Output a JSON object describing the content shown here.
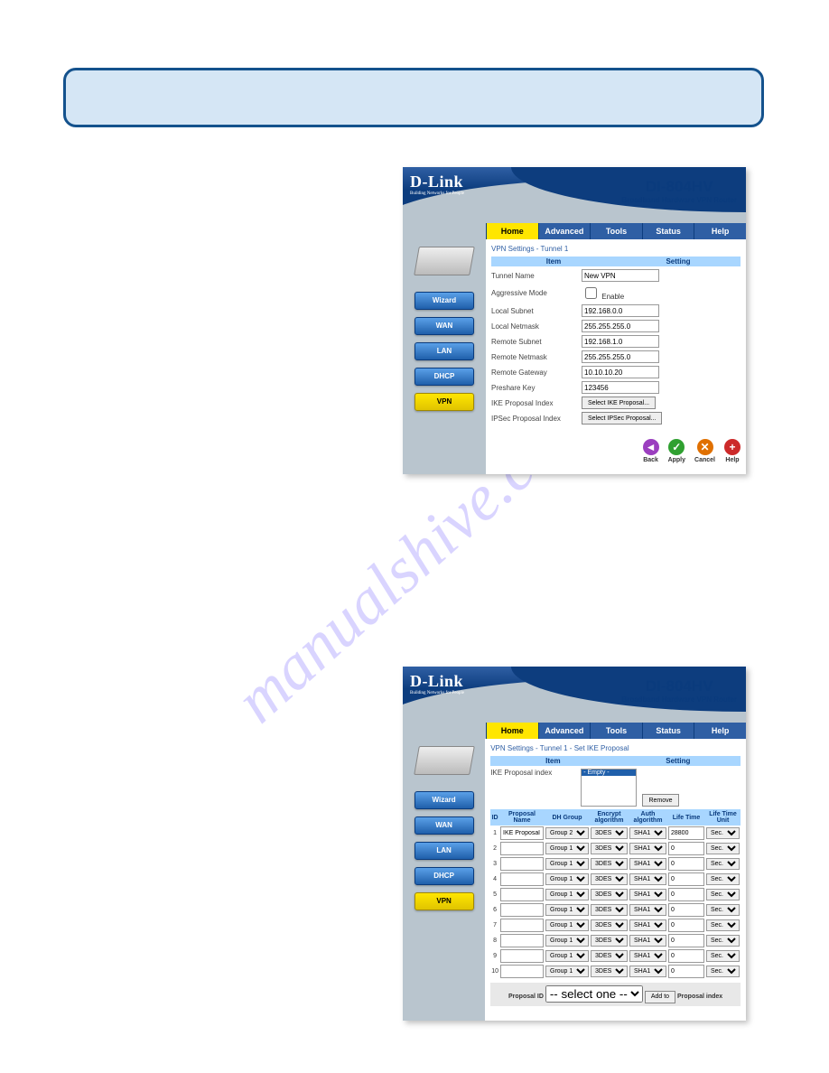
{
  "watermark": "manualshive.com",
  "brand": "D-Link",
  "brand_tagline": "Building Networks for People",
  "product_model": "DI-804HV",
  "product_subtitle": "Broadband Hardware VPN Router",
  "tabs": {
    "home": "Home",
    "advanced": "Advanced",
    "tools": "Tools",
    "status": "Status",
    "help": "Help"
  },
  "sidebar": {
    "wizard": "Wizard",
    "wan": "WAN",
    "lan": "LAN",
    "dhcp": "DHCP",
    "vpn": "VPN"
  },
  "actions": {
    "back": "Back",
    "apply": "Apply",
    "cancel": "Cancel",
    "help": "Help"
  },
  "shot1": {
    "crumb": "VPN Settings - Tunnel 1",
    "headers": {
      "item": "Item",
      "setting": "Setting"
    },
    "rows": {
      "tunnel_name": {
        "label": "Tunnel Name",
        "value": "New VPN"
      },
      "aggressive": {
        "label": "Aggressive Mode",
        "checkbox_label": "Enable"
      },
      "local_subnet": {
        "label": "Local Subnet",
        "value": "192.168.0.0"
      },
      "local_mask": {
        "label": "Local Netmask",
        "value": "255.255.255.0"
      },
      "remote_subnet": {
        "label": "Remote Subnet",
        "value": "192.168.1.0"
      },
      "remote_mask": {
        "label": "Remote Netmask",
        "value": "255.255.255.0"
      },
      "remote_gw": {
        "label": "Remote Gateway",
        "value": "10.10.10.20"
      },
      "preshare": {
        "label": "Preshare Key",
        "value": "123456"
      },
      "ike_idx": {
        "label": "IKE Proposal Index",
        "button": "Select IKE Proposal..."
      },
      "ipsec_idx": {
        "label": "IPSec Proposal Index",
        "button": "Select IPSec Proposal..."
      }
    }
  },
  "shot2": {
    "crumb": "VPN Settings - Tunnel 1 - Set IKE Proposal",
    "headers": {
      "item": "Item",
      "setting": "Setting"
    },
    "ike_label": "IKE Proposal index",
    "list_selected": "- Empty -",
    "remove": "Remove",
    "cols": {
      "id": "ID",
      "name": "Proposal Name",
      "dh": "DH Group",
      "enc": "Encrypt algorithm",
      "auth": "Auth algorithm",
      "life": "Life Time",
      "unit": "Life Time Unit"
    },
    "rows": [
      {
        "id": "1",
        "name": "IKE Proposal",
        "dh": "Group 2",
        "enc": "3DES",
        "auth": "SHA1",
        "life": "28800",
        "unit": "Sec."
      },
      {
        "id": "2",
        "name": "",
        "dh": "Group 1",
        "enc": "3DES",
        "auth": "SHA1",
        "life": "0",
        "unit": "Sec."
      },
      {
        "id": "3",
        "name": "",
        "dh": "Group 1",
        "enc": "3DES",
        "auth": "SHA1",
        "life": "0",
        "unit": "Sec."
      },
      {
        "id": "4",
        "name": "",
        "dh": "Group 1",
        "enc": "3DES",
        "auth": "SHA1",
        "life": "0",
        "unit": "Sec."
      },
      {
        "id": "5",
        "name": "",
        "dh": "Group 1",
        "enc": "3DES",
        "auth": "SHA1",
        "life": "0",
        "unit": "Sec."
      },
      {
        "id": "6",
        "name": "",
        "dh": "Group 1",
        "enc": "3DES",
        "auth": "SHA1",
        "life": "0",
        "unit": "Sec."
      },
      {
        "id": "7",
        "name": "",
        "dh": "Group 1",
        "enc": "3DES",
        "auth": "SHA1",
        "life": "0",
        "unit": "Sec."
      },
      {
        "id": "8",
        "name": "",
        "dh": "Group 1",
        "enc": "3DES",
        "auth": "SHA1",
        "life": "0",
        "unit": "Sec."
      },
      {
        "id": "9",
        "name": "",
        "dh": "Group 1",
        "enc": "3DES",
        "auth": "SHA1",
        "life": "0",
        "unit": "Sec."
      },
      {
        "id": "10",
        "name": "",
        "dh": "Group 1",
        "enc": "3DES",
        "auth": "SHA1",
        "life": "0",
        "unit": "Sec."
      }
    ],
    "bottom": {
      "proposal_id": "Proposal ID",
      "select_one": "-- select one --",
      "addto": "Add to",
      "proposal_index": "Proposal index"
    }
  }
}
